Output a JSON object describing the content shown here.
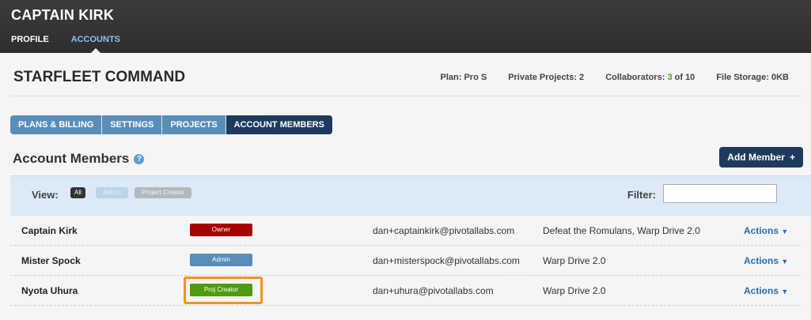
{
  "header": {
    "user_name": "CAPTAIN KIRK",
    "nav": [
      {
        "label": "PROFILE"
      },
      {
        "label": "ACCOUNTS",
        "active": true
      }
    ]
  },
  "account": {
    "title": "STARFLEET COMMAND",
    "plan": "Plan: Pro S",
    "private_projects": "Private Projects: 2",
    "collaborators_prefix": "Collaborators:",
    "collaborators_count": "3",
    "collaborators_suffix": "of 10",
    "file_storage": "File Storage: 0KB"
  },
  "tabs": [
    {
      "label": "PLANS & BILLING"
    },
    {
      "label": "SETTINGS"
    },
    {
      "label": "PROJECTS"
    },
    {
      "label": "ACCOUNT MEMBERS",
      "active": true
    }
  ],
  "members_section": {
    "title": "Account Members",
    "help_icon": "question-circle-icon",
    "add_button": "Add Member",
    "add_icon": "+"
  },
  "filters": {
    "view_label": "View:",
    "views": [
      "All",
      "Admin",
      "Project Creator"
    ],
    "filter_label": "Filter:",
    "filter_value": ""
  },
  "members": [
    {
      "name": "Captain Kirk",
      "role": "Owner",
      "role_color": "#a60000",
      "email": "dan+captainkirk@pivotallabs.com",
      "projects": "Defeat the Romulans, Warp Drive 2.0",
      "actions": "Actions"
    },
    {
      "name": "Mister Spock",
      "role": "Admin",
      "role_color": "#5b8db9",
      "email": "dan+misterspock@pivotallabs.com",
      "projects": "Warp Drive 2.0",
      "actions": "Actions"
    },
    {
      "name": "Nyota Uhura",
      "role": "Proj Creator",
      "role_color": "#4f9a0e",
      "email": "dan+uhura@pivotallabs.com",
      "projects": "Warp Drive 2.0",
      "actions": "Actions"
    }
  ],
  "colors": {
    "accent_dark": "#1e3a5e",
    "accent": "#5b8db9",
    "highlight": "#f5921e"
  }
}
